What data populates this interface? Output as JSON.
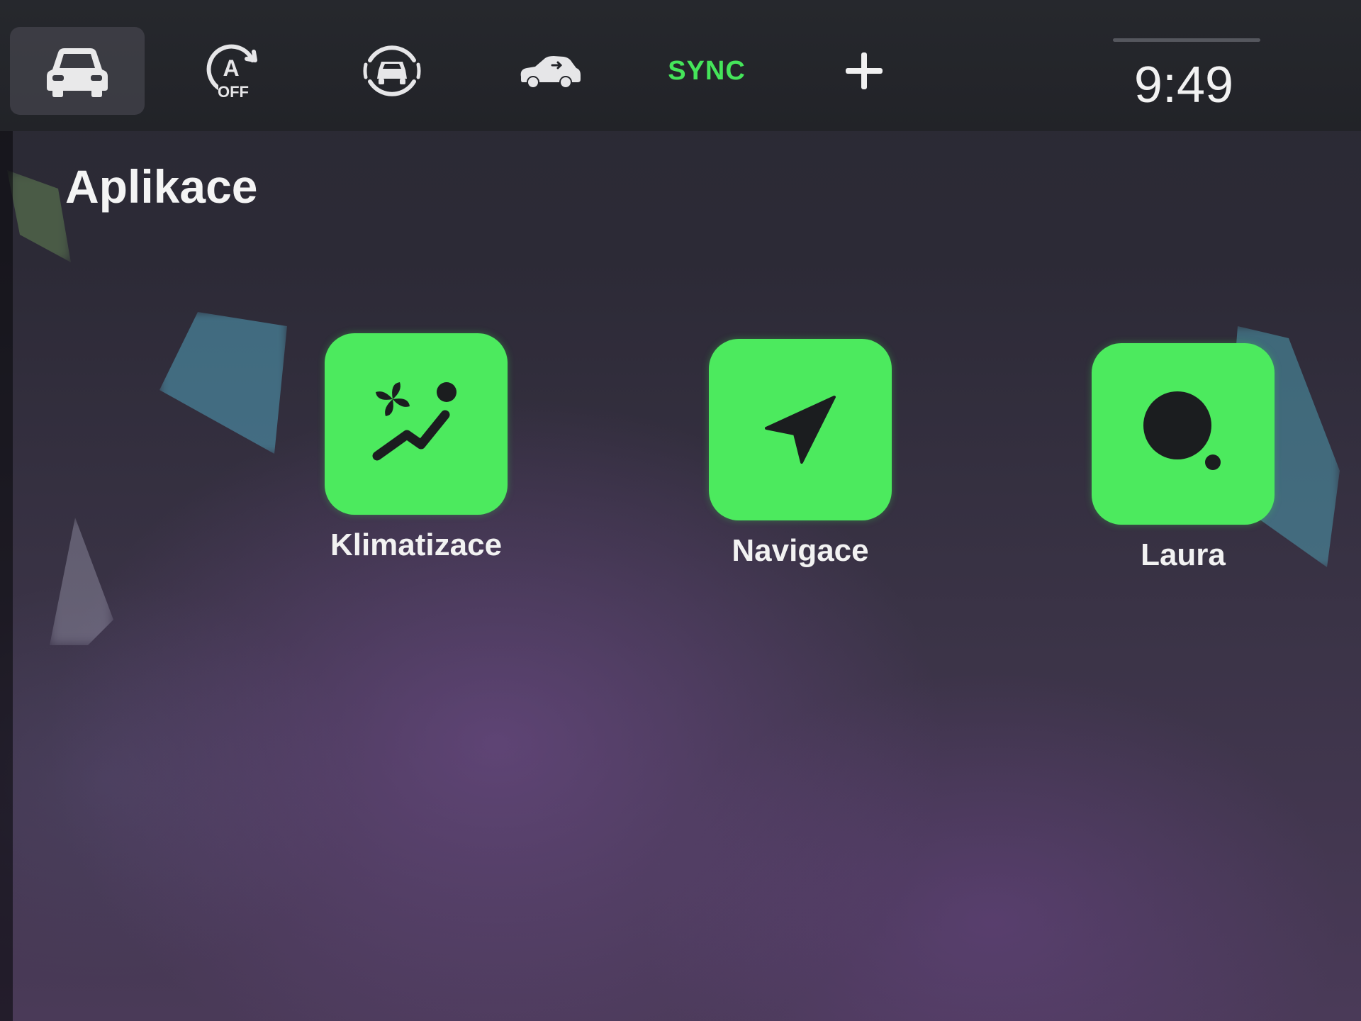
{
  "topbar": {
    "items": [
      {
        "name": "car-icon",
        "active": true
      },
      {
        "name": "auto-start-stop-off-icon",
        "sub_label": "OFF"
      },
      {
        "name": "driver-assist-icon"
      },
      {
        "name": "car-side-icon"
      },
      {
        "name": "sync-label",
        "label": "SYNC"
      },
      {
        "name": "add-icon"
      }
    ],
    "clock": "9:49"
  },
  "section": {
    "title": "Aplikace"
  },
  "apps": [
    {
      "label": "Klimatizace",
      "icon": "climate-fan-seat-icon"
    },
    {
      "label": "Navigace",
      "icon": "navigation-arrow-icon"
    },
    {
      "label": "Laura",
      "icon": "laura-assistant-icon"
    }
  ],
  "colors": {
    "accent": "#4cea5e",
    "sync": "#45e55a",
    "text": "#f2f2f2"
  }
}
